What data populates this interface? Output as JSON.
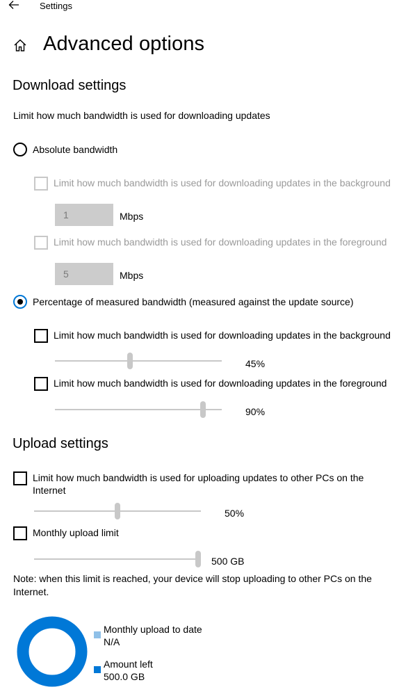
{
  "titlebar": {
    "title": "Settings"
  },
  "page": {
    "title": "Advanced options"
  },
  "download": {
    "section_title": "Download settings",
    "description": "Limit how much bandwidth is used for downloading updates",
    "absolute": {
      "label": "Absolute bandwidth",
      "selected": false,
      "background": {
        "label": "Limit how much bandwidth is used for downloading updates in the background",
        "value": "1",
        "unit": "Mbps"
      },
      "foreground": {
        "label": "Limit how much bandwidth is used for downloading updates in the foreground",
        "value": "5",
        "unit": "Mbps"
      }
    },
    "percentage": {
      "label": "Percentage of measured bandwidth (measured against the update source)",
      "selected": true,
      "background": {
        "label": "Limit how much bandwidth is used for downloading updates in the background",
        "value_label": "45%",
        "value": 0.45
      },
      "foreground": {
        "label": "Limit how much bandwidth is used for downloading updates in the foreground",
        "value_label": "90%",
        "value": 0.9
      }
    }
  },
  "upload": {
    "section_title": "Upload settings",
    "limit": {
      "label_line1": "Limit how much bandwidth is used for uploading updates to other PCs on the",
      "label_line2": "Internet",
      "value_label": "50%",
      "value": 0.5
    },
    "monthly": {
      "label": "Monthly upload limit",
      "value_label": "500 GB",
      "value": 1.0
    },
    "note_line1": "Note: when this limit is reached, your device will stop uploading to other PCs on the",
    "note_line2": "Internet.",
    "legend": [
      {
        "label": "Monthly upload to date",
        "value": "N/A",
        "color": "#8fc0e8"
      },
      {
        "label": "Amount left",
        "value": "500.0 GB",
        "color": "#0078d7"
      }
    ],
    "ring_color": "#0078d7"
  },
  "icons": {
    "back": "back-arrow-icon",
    "home": "home-icon"
  }
}
